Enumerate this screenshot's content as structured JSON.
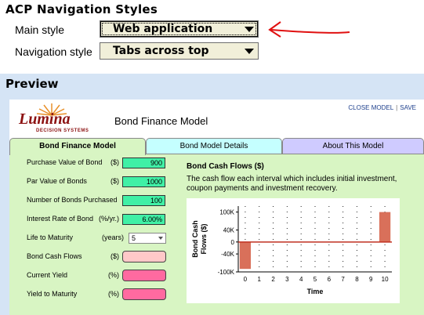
{
  "settings": {
    "heading": "ACP Navigation Styles",
    "main_style": {
      "label": "Main style",
      "value": "Web application"
    },
    "navigation_style": {
      "label": "Navigation style",
      "value": "Tabs across top"
    }
  },
  "preview": {
    "heading": "Preview",
    "logo": {
      "name": "Lumina",
      "tagline": "DECISION SYSTEMS"
    },
    "model_title": "Bond Finance Model",
    "links": {
      "close": "CLOSE MODEL",
      "sep": "|",
      "save": "SAVE"
    },
    "tabs": [
      {
        "label": "Bond Finance Model",
        "active": true
      },
      {
        "label": "Bond Model Details",
        "active": false
      },
      {
        "label": "About This Model",
        "active": false
      }
    ],
    "inputs": [
      {
        "label": "Purchase Value of Bond",
        "unit": "($)",
        "value": "900"
      },
      {
        "label": "Par Value of Bonds",
        "unit": "($)",
        "value": "1000"
      },
      {
        "label": "Number of Bonds Purchased",
        "unit": "",
        "value": "100"
      },
      {
        "label": "Interest Rate of Bond",
        "unit": "(%/yr.)",
        "value": "6.00%"
      }
    ],
    "life": {
      "label": "Life to Maturity",
      "unit": "(years)",
      "value": "5"
    },
    "outputs": [
      {
        "label": "Bond Cash Flows",
        "unit": "($)",
        "color": "#ffc8c8"
      },
      {
        "label": "Current Yield",
        "unit": "(%)",
        "color": "#ff6aa0"
      },
      {
        "label": "Yield to Maturity",
        "unit": "(%)",
        "color": "#ff6aa0"
      }
    ],
    "chart_heading": "Bond Cash Flows ($)",
    "chart_description": "The cash flow each interval which includes initial investment, coupon payments and investment recovery."
  },
  "chart_data": {
    "type": "bar",
    "xlabel": "Time",
    "ylabel": "Bond Cash Flows ($)",
    "categories": [
      0,
      1,
      2,
      3,
      4,
      5,
      6,
      7,
      8,
      9,
      10
    ],
    "values": [
      -90000,
      0,
      0,
      0,
      0,
      0,
      0,
      0,
      0,
      0,
      100000
    ],
    "ylim": [
      -100000,
      120000
    ],
    "yticks": [
      "100K",
      "40K",
      "0",
      "-40K",
      "-100K"
    ],
    "ytick_values": [
      100000,
      40000,
      0,
      -40000,
      -100000
    ],
    "bar_color": "#d9705a",
    "zero_line_color": "#c03020",
    "grid": "dotted"
  }
}
